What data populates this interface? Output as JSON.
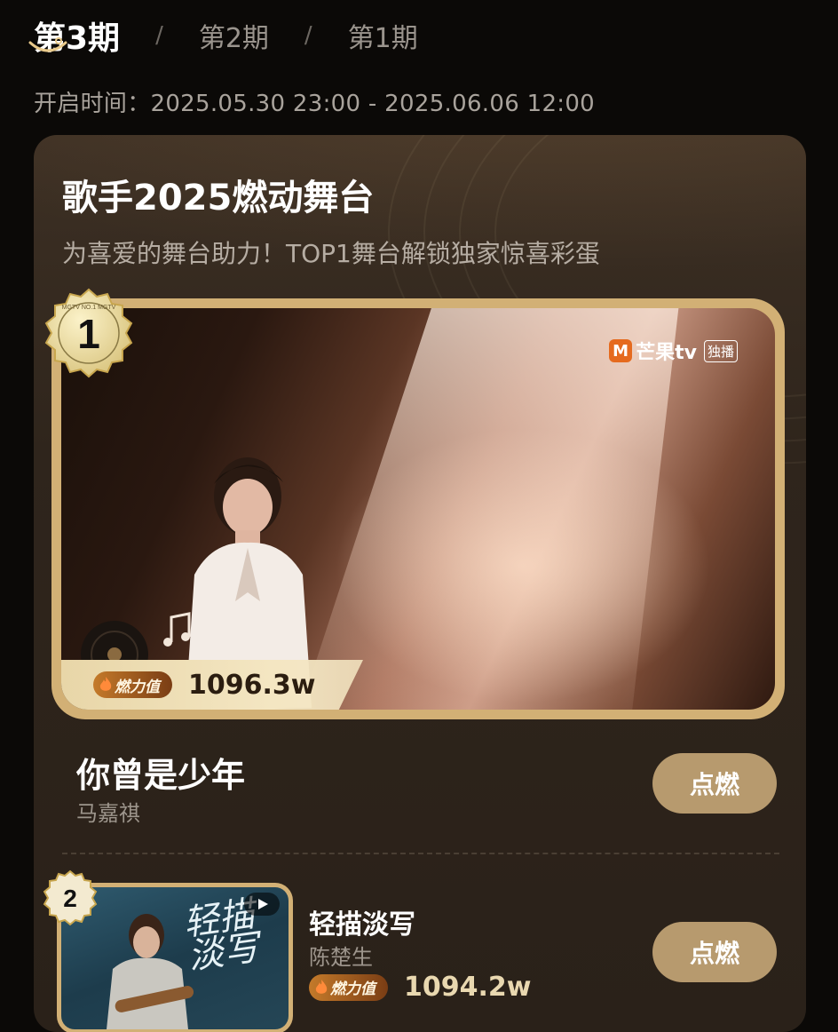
{
  "tabs": [
    {
      "label": "第3期",
      "active": true
    },
    {
      "label": "第2期",
      "active": false
    },
    {
      "label": "第1期",
      "active": false
    }
  ],
  "tab_separator": "/",
  "period": "开启时间：2025.05.30 23:00 - 2025.06.06 12:00",
  "card": {
    "title": "歌手2025燃动舞台",
    "subtitle": "为喜爱的舞台助力！TOP1舞台解锁独家惊喜彩蛋"
  },
  "colors": {
    "gold": "#d2b075",
    "button": "#b79a6e",
    "card_bg": "#2f251c"
  },
  "rankings": [
    {
      "rank": "1",
      "badge_text": "MGTV NO.1 MGTV",
      "song": "你曾是少年",
      "artist": "马嘉祺",
      "score_label": "燃力值",
      "score": "1096.3w",
      "button": "点燃",
      "logo": {
        "mark": "M",
        "text": "芒果tv",
        "tag": "独播"
      }
    },
    {
      "rank": "2",
      "song": "轻描淡写",
      "artist": "陈楚生",
      "score_label": "燃力值",
      "score": "1094.2w",
      "button": "点燃",
      "cover_text": "轻描淡写"
    }
  ]
}
